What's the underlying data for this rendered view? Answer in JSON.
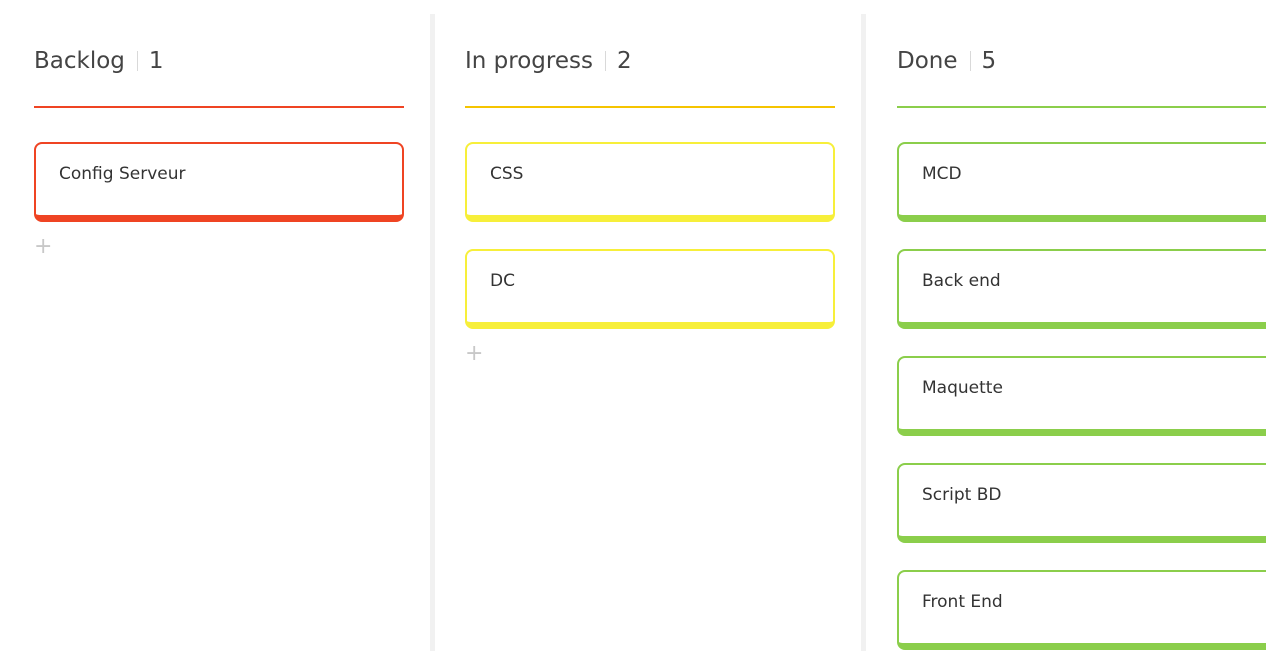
{
  "columns": [
    {
      "title": "Backlog",
      "count": "1",
      "color": "#ef4423",
      "cards": [
        "Config Serveur"
      ],
      "add_icon": "plus-icon",
      "add_glyph": "+"
    },
    {
      "title": "In progress",
      "count": "2",
      "color": "#f5c400",
      "card_border_color": "#f7ef3a",
      "cards": [
        "CSS",
        "DC"
      ],
      "add_icon": "plus-icon",
      "add_glyph": "+"
    },
    {
      "title": "Done",
      "count": "5",
      "color": "#8bce4b",
      "cards": [
        "MCD",
        "Back end",
        "Maquette",
        "Script BD",
        "Front End"
      ]
    }
  ]
}
